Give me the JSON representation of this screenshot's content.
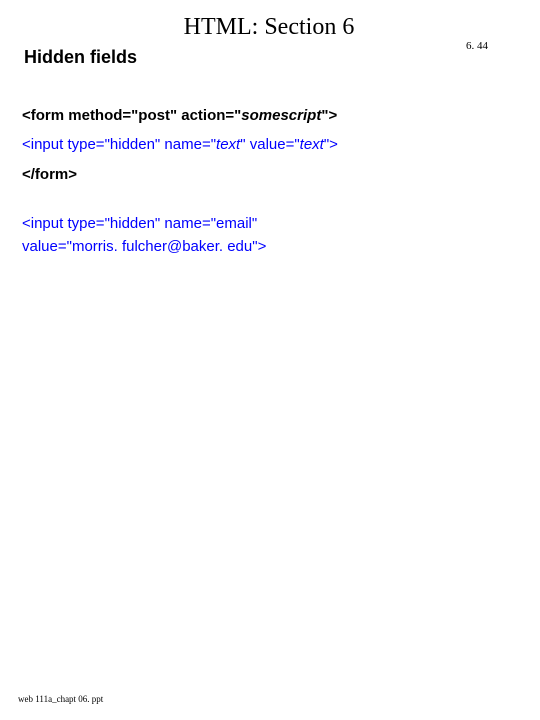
{
  "title": "HTML: Section 6",
  "subtitle": "Hidden fields",
  "page_number": "6. 44",
  "code1": {
    "pre1": "<form method=\"post\" action=\"",
    "ital1": "somescript",
    "post1": "\">",
    "pre2": "<input type=\"hidden\" name=\"",
    "ital2a": "text",
    "mid2": "\" value=\"",
    "ital2b": "text",
    "post2": "\">",
    "close": "</form>"
  },
  "code2": {
    "l1": "<input type=\"hidden\" name=\"email\"",
    "l2": "value=\"morris. fulcher@baker. edu\">"
  },
  "footer": "web 111a_chapt 06. ppt"
}
